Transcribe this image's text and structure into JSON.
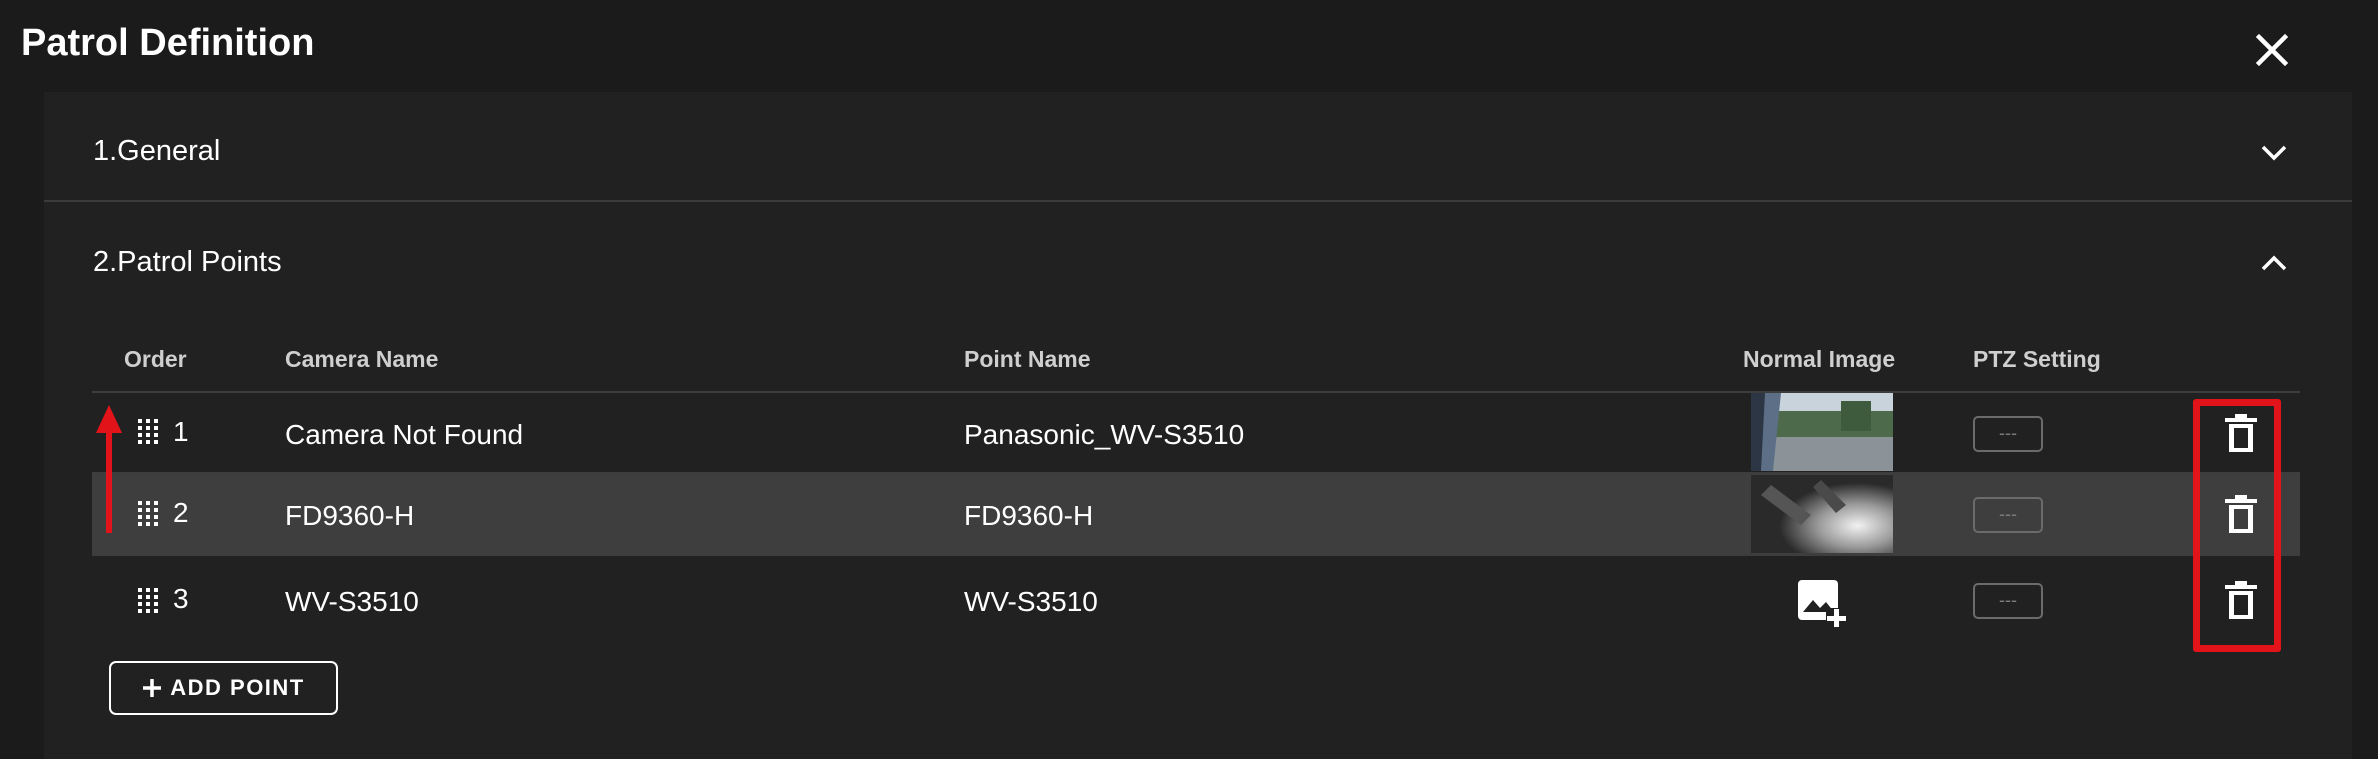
{
  "dialog": {
    "title": "Patrol Definition",
    "close_icon": "close-icon"
  },
  "sections": [
    {
      "title": "1.General",
      "expanded": false,
      "icon": "chevron-down-icon"
    },
    {
      "title": "2.Patrol Points",
      "expanded": true,
      "icon": "chevron-up-icon"
    }
  ],
  "table": {
    "headers": {
      "order": "Order",
      "camera_name": "Camera Name",
      "point_name": "Point Name",
      "normal_image": "Normal Image",
      "ptz_setting": "PTZ Setting"
    },
    "rows": [
      {
        "order": "1",
        "camera_name": "Camera Not Found",
        "point_name": "Panasonic_WV-S3510",
        "normal_image": "thumbnail",
        "ptz": "---",
        "highlighted": false
      },
      {
        "order": "2",
        "camera_name": "FD9360-H",
        "point_name": "FD9360-H",
        "normal_image": "thumbnail",
        "ptz": "---",
        "highlighted": true
      },
      {
        "order": "3",
        "camera_name": "WV-S3510",
        "point_name": "WV-S3510",
        "normal_image": "add-image-icon",
        "ptz": "---",
        "highlighted": false
      }
    ]
  },
  "add_point": {
    "label": "ADD POINT",
    "icon": "plus-icon"
  },
  "annotations": {
    "highlight_color": "#e3131a"
  },
  "colors": {
    "background": "#1b1b1b",
    "panel": "#212121",
    "selected_row": "#3e3e3e"
  }
}
